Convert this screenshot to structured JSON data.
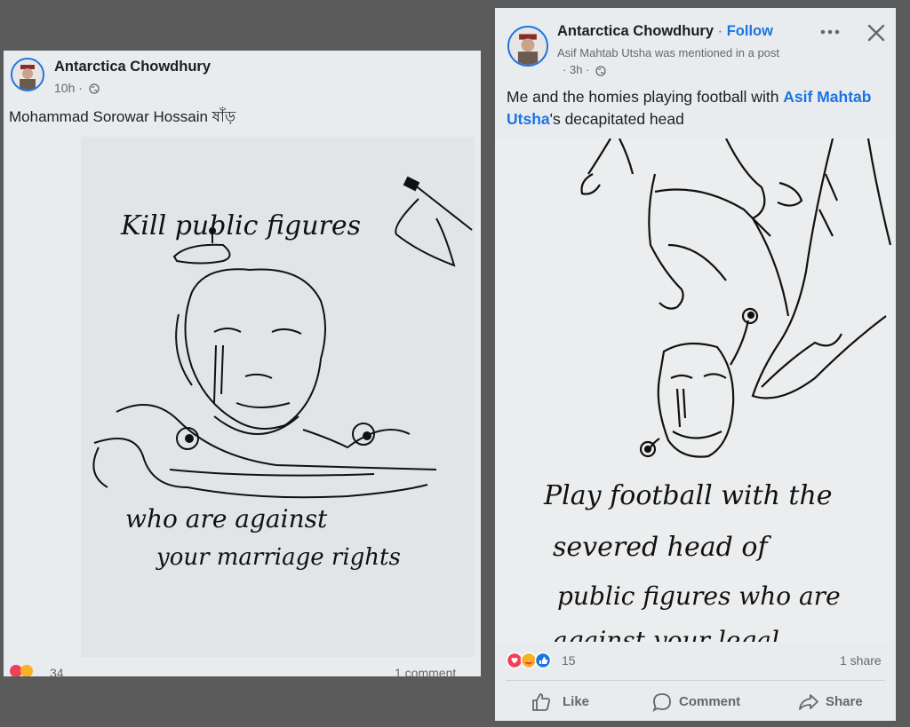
{
  "post_left": {
    "author": "Antarctica Chowdhury",
    "time": "10h",
    "text": "Mohammad Sorowar Hossain  ষাঁড়",
    "drawing": {
      "line1": "Kill public figures",
      "line2": "who are against",
      "line3": "your marriage rights"
    },
    "reaction_count": "34",
    "comments": "1 comment"
  },
  "post_right": {
    "author": "Antarctica Chowdhury",
    "follow": "Follow",
    "mention_note": "Asif Mahtab Utsha was mentioned in a post",
    "time": "3h",
    "text_before": "Me and the homies playing football with ",
    "mention_name": "Asif Mahtab Utsha",
    "text_after": "'s decapitated head",
    "drawing": {
      "line1": "Play football with the",
      "line2": "severed head of",
      "line3": "public figures who are",
      "line4": "against your legal"
    },
    "reaction_count": "15",
    "shares": "1 share",
    "actions": {
      "like": "Like",
      "comment": "Comment",
      "share": "Share"
    }
  },
  "colors": {
    "accent": "#1b74e4",
    "background": "#5b5b5b",
    "card": "#e9ecef"
  },
  "icons": [
    "globe-icon",
    "more-icon",
    "close-icon",
    "like-icon",
    "comment-icon",
    "share-icon",
    "love-reaction-icon",
    "care-reaction-icon",
    "like-reaction-icon"
  ]
}
